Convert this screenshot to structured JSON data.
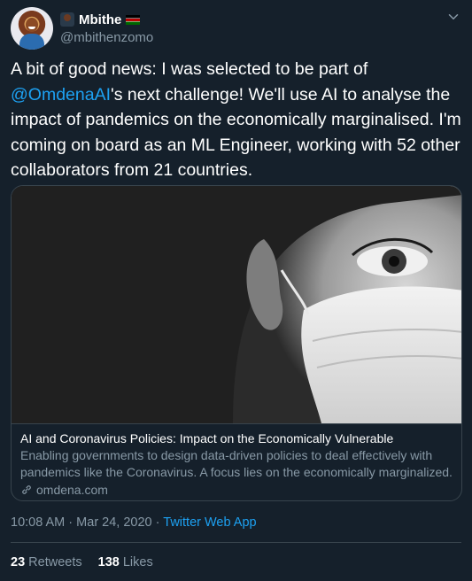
{
  "author": {
    "display_name": "Mbithe",
    "handle": "@mbithenzomo"
  },
  "tweet": {
    "text_before_mention": "A bit of good news: I was selected to be part of ",
    "mention": "@OmdenaAI",
    "text_after_mention": "'s next challenge! We'll use AI to analyse the impact of pandemics on the economically marginalised. I'm  coming on board as an ML Engineer, working with 52 other collaborators from 21 countries."
  },
  "card": {
    "title": "AI and Coronavirus Policies: Impact on the Economically Vulnerable",
    "description": "Enabling governments to design data-driven policies to deal effectively with pandemics like the Coronavirus. A focus lies on the economically marginalized.",
    "domain": "omdena.com"
  },
  "meta": {
    "time": "10:08 AM",
    "separator": "·",
    "date": "Mar 24, 2020",
    "app": "Twitter Web App"
  },
  "stats": {
    "retweets_count": "23",
    "retweets_label": "Retweets",
    "likes_count": "138",
    "likes_label": "Likes"
  },
  "colors": {
    "background": "#15202b",
    "accent": "#1da1f2",
    "secondary_text": "#8899a6",
    "border": "#38444d"
  },
  "icons": [
    "avatar",
    "kenya-flag-icon",
    "chevron-down-icon",
    "link-icon"
  ]
}
